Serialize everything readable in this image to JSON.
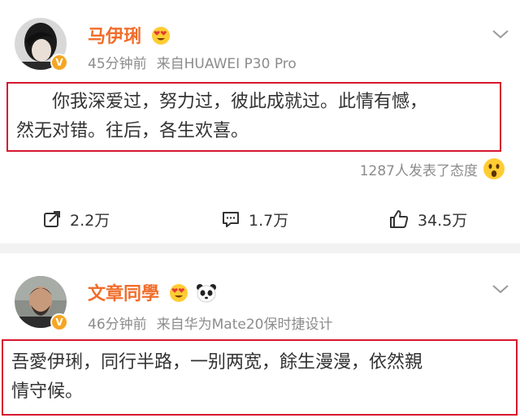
{
  "post1": {
    "username": "马伊琍",
    "time": "45分钟前",
    "source": "来自HUAWEI P30 Pro",
    "content_line1": "你我深爱过，努力过，彼此成就过。此情有憾，",
    "content_line2": "然无对错。往后，各生欢喜。",
    "reaction_summary": "1287人发表了态度",
    "actions": {
      "share_count": "2.2万",
      "comment_count": "1.7万",
      "like_count": "34.5万"
    }
  },
  "post2": {
    "username": "文章同學",
    "time": "46分钟前",
    "source": "来自华为Mate20保时捷设计",
    "content_line1": "吾愛伊琍，同行半路，一别两宽，餘生漫漫，依然親",
    "content_line2": "情守候。"
  },
  "colors": {
    "username": "#f06d2b",
    "highlight_border": "#d6162f",
    "verified_badge": "#f5a623",
    "meta_text": "#8c8c8c"
  },
  "icons": [
    "chevron-down-icon",
    "verified-v-icon",
    "surprised-emoji-icon",
    "share-icon",
    "comment-icon",
    "like-icon",
    "heart-eyes-emoji-icon",
    "panda-emoji-icon"
  ]
}
